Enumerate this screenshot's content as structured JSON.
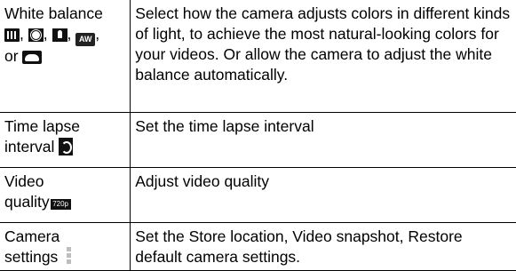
{
  "rows": [
    {
      "label": "White balance",
      "separators": [
        ",",
        ",",
        ",",
        ","
      ],
      "or": "or",
      "icons": [
        "incandescent-icon",
        "daylight-icon",
        "fluorescent-icon",
        "auto-white-balance-icon",
        "cloudy-icon"
      ],
      "aw_text": "AW",
      "description": "Select how the camera adjusts colors in different kinds of light, to achieve the most natural-looking colors for your videos. Or allow the camera to adjust the white balance automatically."
    },
    {
      "label": "Time lapse interval",
      "icons": [
        "time-lapse-icon"
      ],
      "description": "Set the time lapse interval"
    },
    {
      "label_part1": "Video",
      "label_part2": "quality",
      "icons": [
        "video-quality-720p-icon"
      ],
      "badge_text": "720p",
      "description": "Adjust video quality"
    },
    {
      "label_part1": "Camera",
      "label_part2": "settings",
      "icons": [
        "more-options-icon"
      ],
      "description": "Set the Store location, Video snapshot, Restore default camera settings."
    }
  ]
}
